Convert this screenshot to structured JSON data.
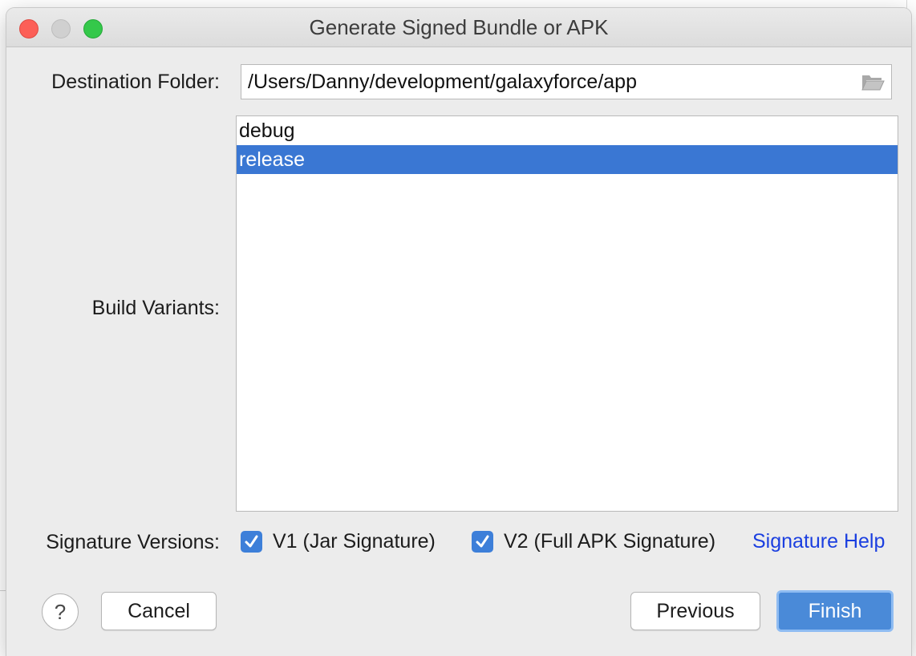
{
  "window": {
    "title": "Generate Signed Bundle or APK"
  },
  "destination": {
    "label": "Destination Folder:",
    "value": "/Users/Danny/development/galaxyforce/app"
  },
  "build_variants": {
    "label": "Build Variants:",
    "items": [
      {
        "label": "debug",
        "selected": false
      },
      {
        "label": "release",
        "selected": true
      }
    ]
  },
  "signature": {
    "label": "Signature Versions:",
    "v1_label": "V1 (Jar Signature)",
    "v1_checked": true,
    "v2_label": "V2 (Full APK Signature)",
    "v2_checked": true,
    "help_link": "Signature Help"
  },
  "buttons": {
    "help": "?",
    "cancel": "Cancel",
    "previous": "Previous",
    "finish": "Finish"
  },
  "colors": {
    "selection": "#3a77d3",
    "link": "#1b3fe0",
    "primary_button": "#4a8ad8",
    "checkbox": "#3d7fd9"
  }
}
